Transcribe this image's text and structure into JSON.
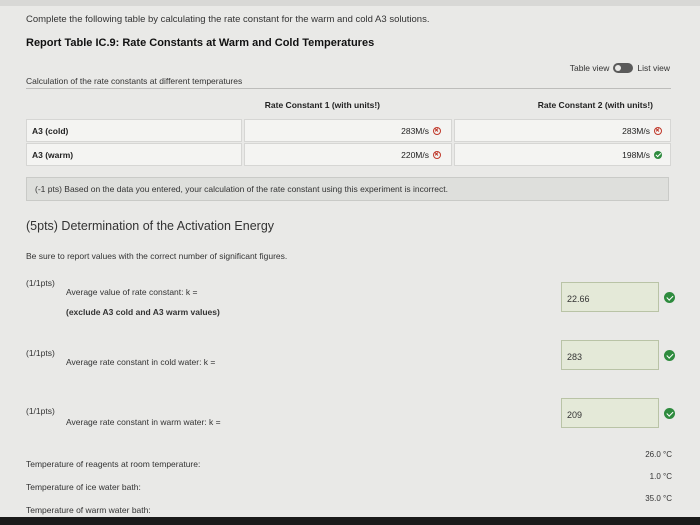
{
  "instructions": "Complete the following table by calculating the rate constant for the warm and cold A3 solutions.",
  "report_title": "Report Table IC.9: Rate Constants at Warm and Cold Temperatures",
  "view_toggle": {
    "table_view": "Table view",
    "list_view": "List view"
  },
  "table_caption": "Calculation of the rate constants at different temperatures",
  "table": {
    "headers": [
      "",
      "Rate Constant 1 (with units!)",
      "Rate Constant 2 (with units!)"
    ],
    "rows": [
      {
        "label": "A3 (cold)",
        "rc1": "283M/s",
        "rc1_status": "incorrect",
        "rc2": "283M/s",
        "rc2_status": "incorrect"
      },
      {
        "label": "A3 (warm)",
        "rc1": "220M/s",
        "rc1_status": "incorrect",
        "rc2": "198M/s",
        "rc2_status": "correct"
      }
    ]
  },
  "feedback": "(-1 pts) Based on the data you entered, your calculation of the rate constant using this experiment is incorrect.",
  "section_title": "(5pts) Determination of the Activation Energy",
  "sig_fig_note": "Be sure to report values with the correct number of significant figures.",
  "questions": [
    {
      "points": "(1/1pts)",
      "text": "Average value of rate constant: k =",
      "subtext": "(exclude A3 cold and A3 warm values)",
      "answer": "22.66"
    },
    {
      "points": "(1/1pts)",
      "text": "Average rate constant in cold water: k =",
      "answer": "283"
    },
    {
      "points": "(1/1pts)",
      "text": "Average rate constant in warm water: k =",
      "answer": "209"
    }
  ],
  "temperatures": [
    {
      "label": "Temperature of reagents at room temperature:",
      "value": "26.0 °C"
    },
    {
      "label": "Temperature of ice water bath:",
      "value": "1.0 °C"
    },
    {
      "label": "Temperature of warm water bath:",
      "value": "35.0 °C"
    }
  ],
  "colors": {
    "correct": "#2e8b3e",
    "incorrect": "#c0392b",
    "answer_bg": "#e4e9d8"
  }
}
